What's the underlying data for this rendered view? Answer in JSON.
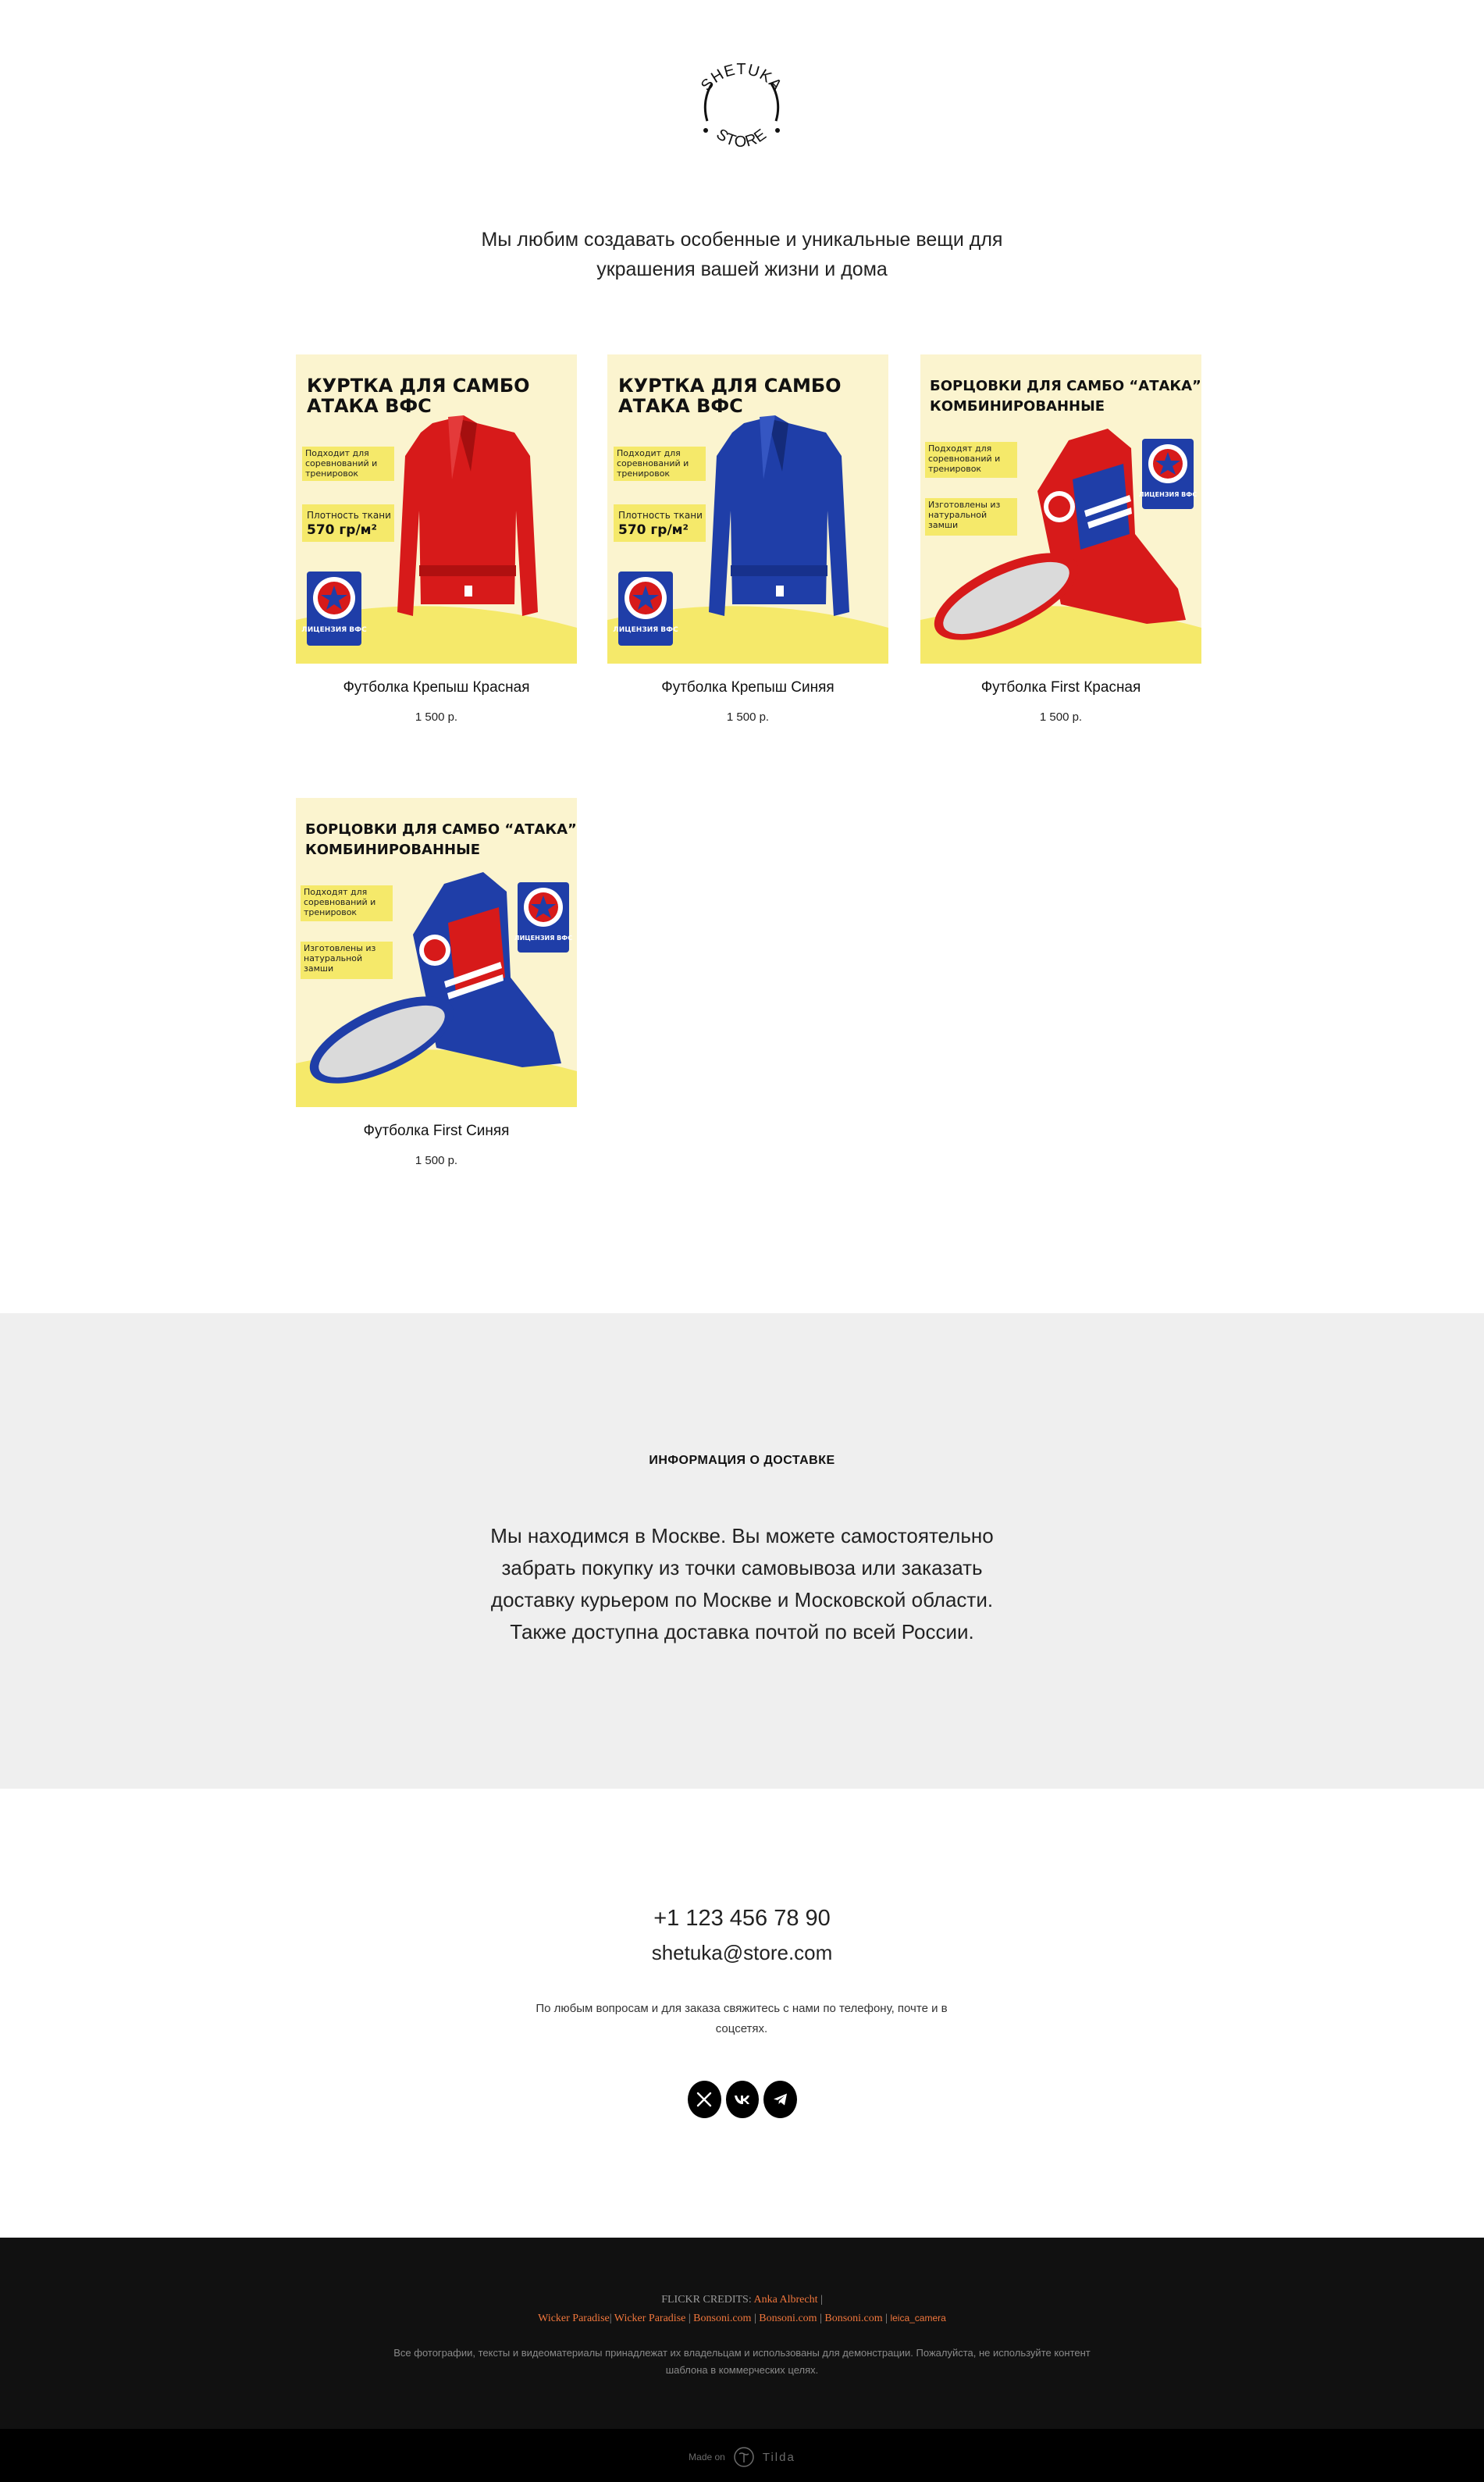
{
  "brand": {
    "logo_top": "SHETUKA",
    "logo_bottom": "STORE"
  },
  "tagline": "Мы любим создавать особенные и уникальные вещи для украшения вашей жизни и дома",
  "products": [
    {
      "title": "Футболка Крепыш Красная",
      "price": "1 500 р.",
      "banner_title_1": "КУРТКА ДЛЯ САМБО",
      "banner_title_2": "АТАКА ВФС",
      "feature_1": "Подходит для соревнований и тренировок",
      "feature_2_label": "Плотность ткани",
      "feature_2_value": "570 гр/м²",
      "badge": "ЛИЦЕНЗИЯ ВФС",
      "color": "#d71a1a"
    },
    {
      "title": "Футболка Крепыш Синяя",
      "price": "1 500 р.",
      "banner_title_1": "КУРТКА ДЛЯ САМБО",
      "banner_title_2": "АТАКА ВФС",
      "feature_1": "Подходит для соревнований и тренировок",
      "feature_2_label": "Плотность ткани",
      "feature_2_value": "570 гр/м²",
      "badge": "ЛИЦЕНЗИЯ ВФС",
      "color": "#1f3ea8"
    },
    {
      "title": "Футболка First Красная",
      "price": "1 500 р.",
      "banner_title_1": "БОРЦОВКИ ДЛЯ САМБО “АТАКА”",
      "banner_title_2": "КОМБИНИРОВАННЫЕ",
      "feature_1": "Подходят для соревнований и тренировок",
      "feature_2_label": "Изготовлены из натуральной замши",
      "feature_2_value": "",
      "badge": "ЛИЦЕНЗИЯ ВФС",
      "color": "#d71a1a"
    },
    {
      "title": "Футболка First Синяя",
      "price": "1 500 р.",
      "banner_title_1": "БОРЦОВКИ ДЛЯ САМБО “АТАКА”",
      "banner_title_2": "КОМБИНИРОВАННЫЕ",
      "feature_1": "Подходят для соревнований и тренировок",
      "feature_2_label": "Изготовлены из натуральной замши",
      "feature_2_value": "",
      "badge": "ЛИЦЕНЗИЯ ВФС",
      "color": "#1f3ea8"
    }
  ],
  "delivery": {
    "heading": "ИНФОРМАЦИЯ О ДОСТАВКЕ",
    "body": "Мы находимся в Москве. Вы можете самостоятельно забрать покупку из точки самовывоза или заказать доставку курьером по Москве и Московской области. Также доступна доставка почтой по всей России."
  },
  "contacts": {
    "phone": "+1 123 456 78 90",
    "email": "shetuka@store.com",
    "note": "По любым вопросам и для заказа свяжитесь с нами по телефону, почте и в соцсетях.",
    "socials": [
      "x-icon",
      "vk-icon",
      "telegram-icon"
    ]
  },
  "footer": {
    "credits_label": "FLICKR CREDITS:",
    "credit_1": "Anka Albrecht",
    "credit_2": "Wicker Paradise",
    "credit_3": "Wicker Paradise",
    "credit_4": "Bonsoni.com",
    "credit_5": "Bonsoni.com",
    "credit_6": "Bonsoni.com",
    "credit_7": "leica_camera",
    "disclaimer": "Все фотографии, тексты и видеоматериалы принадлежат их владельцам и использованы для демонстрации. Пожалуйста, не используйте контент шаблона в коммерческих целях.",
    "made_on": "Made on",
    "tilda": "Tilda"
  },
  "colors": {
    "accent_link": "#f0763c",
    "delivery_bg": "#efefef",
    "footer_bg": "#111111",
    "banner_bg": "#fbf4cf",
    "badge_blue": "#1f3ea8"
  }
}
